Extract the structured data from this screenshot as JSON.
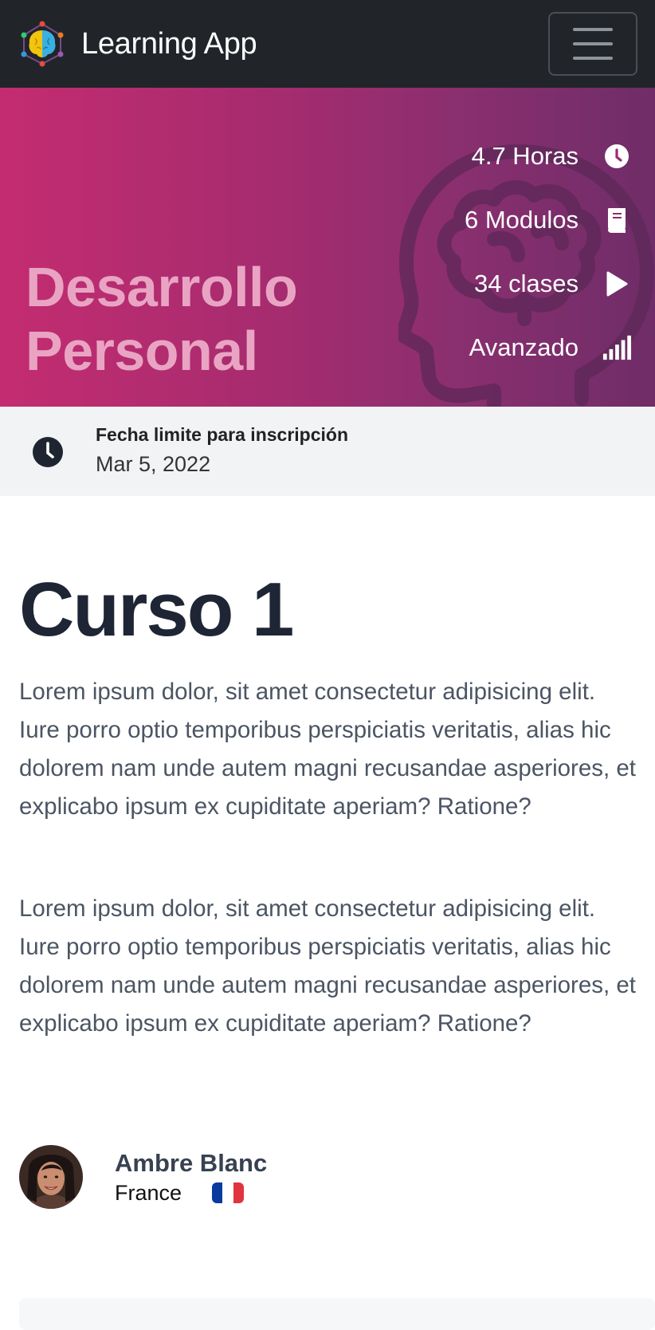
{
  "navbar": {
    "app_name": "Learning App",
    "menu_icon": "hamburger-icon",
    "logo_icon": "brain-network-logo"
  },
  "hero": {
    "title_line1": "Desarrollo",
    "title_line2": "Personal",
    "background_icon": "head-brain-icon",
    "gradient_start": "#c42c70",
    "gradient_end": "#6f2d68",
    "stats": [
      {
        "label": "4.7 Horas",
        "icon": "clock-icon"
      },
      {
        "label": "6 Modulos",
        "icon": "book-icon"
      },
      {
        "label": "34 clases",
        "icon": "play-icon"
      },
      {
        "label": "Avanzado",
        "icon": "signal-bars-icon"
      }
    ]
  },
  "deadline": {
    "label": "Fecha limite para inscripción",
    "date": "Mar 5, 2022",
    "icon": "clock-icon"
  },
  "course": {
    "title": "Curso 1",
    "paragraphs": [
      "Lorem ipsum dolor, sit amet consectetur adipisicing elit. Iure porro optio temporibus perspiciatis veritatis, alias hic dolorem nam unde autem magni recusandae asperiores, et explicabo ipsum ex cupiditate aperiam? Ratione?",
      "Lorem ipsum dolor, sit amet consectetur adipisicing elit. Iure porro optio temporibus perspiciatis veritatis, alias hic dolorem nam unde autem magni recusandae asperiores, et explicabo ipsum ex cupiditate aperiam? Ratione?"
    ]
  },
  "author": {
    "name": "Ambre Blanc",
    "country": "France",
    "flag_icon": "france-flag-icon",
    "flag_colors": [
      "#0a3a9e",
      "#ffffff",
      "#e0343f"
    ]
  }
}
